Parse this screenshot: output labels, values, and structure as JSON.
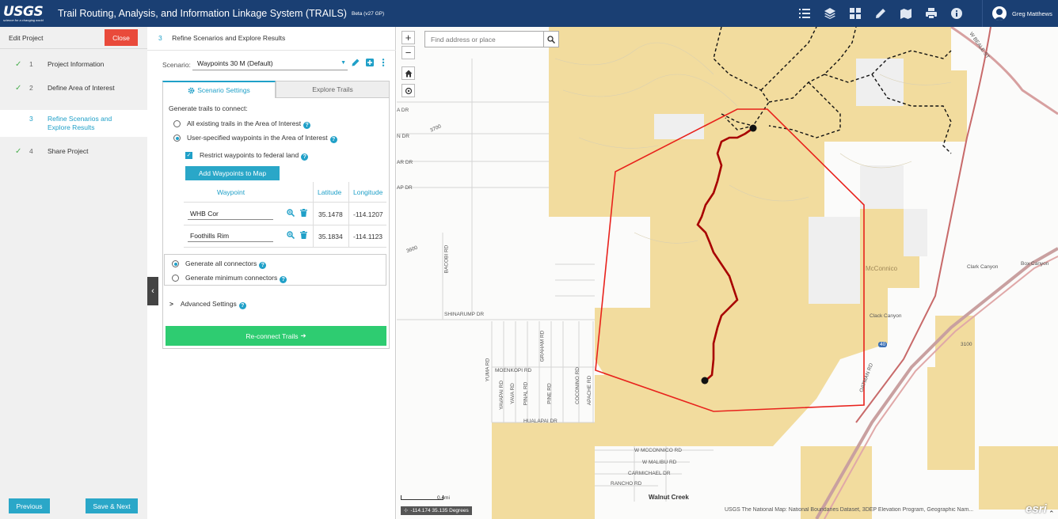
{
  "header": {
    "logo_text": "USGS",
    "logo_tagline": "science for a changing world",
    "title": "Trail Routing, Analysis, and Information Linkage System (TRAILS)",
    "version": "Beta (v27 GP)",
    "tools": [
      "list-icon",
      "layers-icon",
      "grid-icon",
      "pencil-icon",
      "map-icon",
      "print-icon",
      "info-icon"
    ],
    "user_name": "Greg Matthews",
    "bg_color": "#1a3f73"
  },
  "steps": {
    "edit_project": "Edit Project",
    "close_label": "Close",
    "items": [
      {
        "num": "1",
        "label": "Project Information",
        "status": "complete"
      },
      {
        "num": "2",
        "label": "Define Area of Interest",
        "status": "complete"
      },
      {
        "num": "3",
        "label": "Refine Scenarios and Explore Results",
        "status": "active"
      },
      {
        "num": "4",
        "label": "Share Project",
        "status": "complete"
      }
    ],
    "prev_label": "Previous",
    "next_label": "Save & Next"
  },
  "panel": {
    "step_num": "3",
    "title": "Refine Scenarios and Explore Results",
    "scenario_label": "Scenario:",
    "scenario_value": "Waypoints 30 M (Default)",
    "tabs": {
      "scenario": "Scenario Settings",
      "explore": "Explore Trails"
    },
    "generate_heading": "Generate trails to connect:",
    "options": {
      "all_trails": "All existing trails in the Area of Interest",
      "user_waypoints": "User-specified waypoints in the Area of Interest",
      "selected": "user_waypoints"
    },
    "restrict_label": "Restrict waypoints to federal land",
    "restrict_checked": true,
    "add_waypoints_label": "Add Waypoints to Map",
    "waypoint_headers": {
      "waypoint": "Waypoint",
      "latitude": "Latitude",
      "longitude": "Longitude"
    },
    "waypoints": [
      {
        "name": "WHB Cor",
        "lat": "35.1478",
        "lon": "-114.1207"
      },
      {
        "name": "Foothills Rim",
        "lat": "35.1834",
        "lon": "-114.1123"
      }
    ],
    "connectors": {
      "all": "Generate all connectors",
      "minimum": "Generate minimum connectors",
      "selected": "all"
    },
    "advanced_label": "Advanced Settings",
    "reconnect_label": "Re-connect Trails"
  },
  "map": {
    "search_placeholder": "Find address or place",
    "scale_label": "0.4mi",
    "coords": "-114.174 35.135 Degrees",
    "attribution": "USGS The National Map: National Boundaries Dataset, 3DEP Elevation Program, Geographic Nam...",
    "esri": "esri",
    "labels": {
      "shinarump": "SHINARUMP DR",
      "bacobi": "BACOBI RD",
      "moenkopi": "MOENKOPI RD",
      "yuma": "YUMA RD",
      "yavapai": "YAVAPAI RD",
      "yava": "YAVA RD",
      "pinal": "PINAL RD",
      "graham": "GRAHAM RD",
      "pine": "PINE RD",
      "coconino": "COCONINO RD",
      "apache": "APACHE RD",
      "hualapai": "HUALAPAI DR",
      "mcconnico_rd": "W MCCONNICO RD",
      "malibu": "W MALIBU RD",
      "carmichael": "CARMICHAEL DR",
      "rancho": "RANCHO RD",
      "walnut": "Walnut Creek",
      "mcconnico": "McConnico",
      "clack": "Clack Canyon",
      "clark": "Clark Canyon",
      "box": "Box Canyon",
      "i40": "40",
      "oatman": "OATMAN RD",
      "beale": "W BEALE ST",
      "dr1": "A DR",
      "dr2": "N DR",
      "dr3": "AR DR",
      "dr4": "AP DR",
      "elev1": "3700",
      "elev2": "3600",
      "elev3": "3100"
    },
    "colors": {
      "federal_land": "#f2dc9e",
      "aoi_outline": "#e8221c",
      "trail": "#b00000",
      "existing_trails": "#111111"
    }
  }
}
